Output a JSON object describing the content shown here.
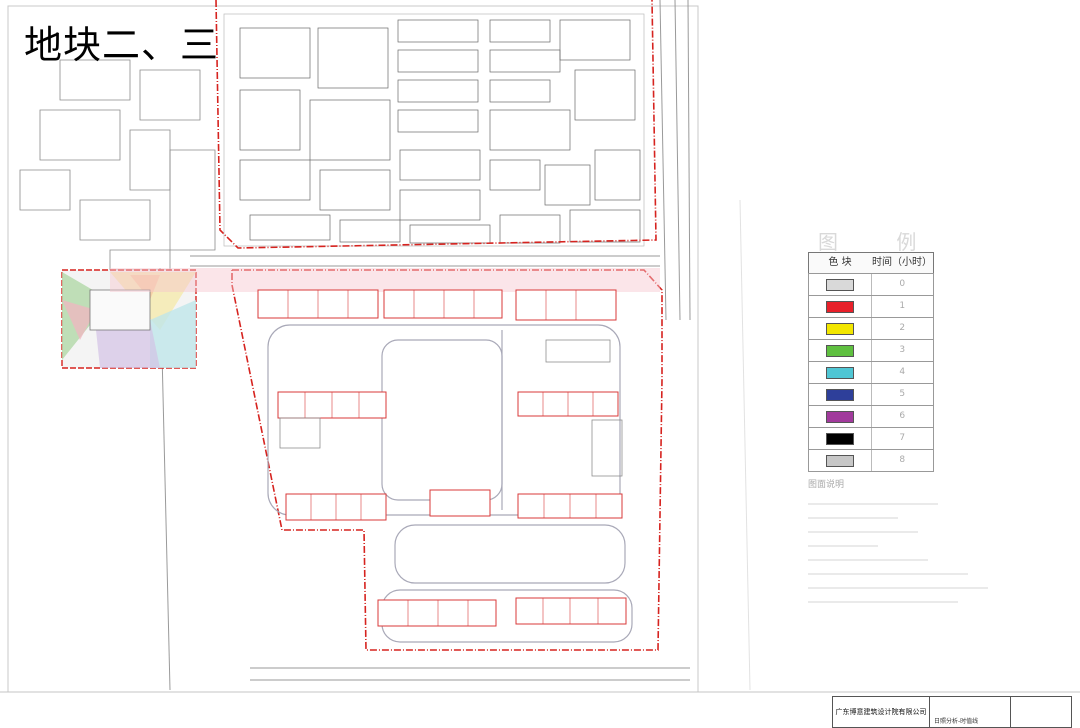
{
  "slide": {
    "title": "地块二、三"
  },
  "legend": {
    "title": "图 例",
    "col_color": "色 块",
    "col_time": "时间（小时）",
    "rows": [
      {
        "hours": "0",
        "color": "#d9d9d9"
      },
      {
        "hours": "1",
        "color": "#e8202a"
      },
      {
        "hours": "2",
        "color": "#f2e600"
      },
      {
        "hours": "3",
        "color": "#5fc040"
      },
      {
        "hours": "4",
        "color": "#4fc6d4"
      },
      {
        "hours": "5",
        "color": "#2e3f9a"
      },
      {
        "hours": "6",
        "color": "#a13a9c"
      },
      {
        "hours": "7",
        "color": "#000000"
      },
      {
        "hours": "8",
        "color": "#c7c7c7"
      }
    ]
  },
  "notes_heading": "图面说明",
  "title_block": {
    "company": "广东博意建筑设计院有限公司",
    "drawing_name": "日照分析-时值线"
  }
}
